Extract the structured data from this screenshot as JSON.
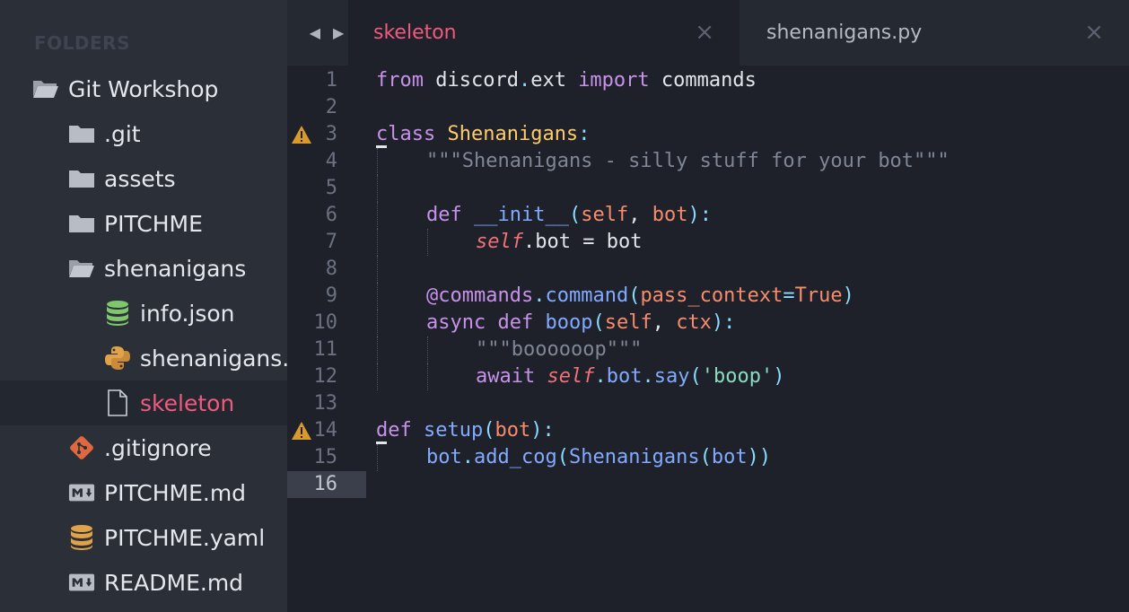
{
  "sidebar": {
    "header": "FOLDERS",
    "items": [
      {
        "label": "Git Workshop",
        "icon": "folder-open-icon"
      },
      {
        "label": ".git",
        "icon": "folder-icon"
      },
      {
        "label": "assets",
        "icon": "folder-icon"
      },
      {
        "label": "PITCHME",
        "icon": "folder-icon"
      },
      {
        "label": "shenanigans",
        "icon": "folder-open-icon"
      },
      {
        "label": "info.json",
        "icon": "database-icon"
      },
      {
        "label": "shenanigans.",
        "icon": "python-icon"
      },
      {
        "label": "skeleton",
        "icon": "file-icon"
      },
      {
        "label": ".gitignore",
        "icon": "git-icon"
      },
      {
        "label": "PITCHME.md",
        "icon": "markdown-icon"
      },
      {
        "label": "PITCHME.yaml",
        "icon": "database-icon"
      },
      {
        "label": "README.md",
        "icon": "markdown-icon"
      }
    ]
  },
  "tabs": [
    {
      "label": "skeleton",
      "active": true,
      "close": "×"
    },
    {
      "label": "shenanigans.py",
      "active": false,
      "close": "×"
    }
  ],
  "nav": {
    "back": "◀",
    "forward": "▶"
  },
  "editor": {
    "current_line": 16,
    "warnings_on_lines": [
      3,
      14
    ],
    "line_numbers": [
      "1",
      "2",
      "3",
      "4",
      "5",
      "6",
      "7",
      "8",
      "9",
      "10",
      "11",
      "12",
      "13",
      "14",
      "15",
      "16"
    ],
    "code": {
      "l1": [
        "from",
        " discord",
        ".",
        "ext ",
        "import",
        " commands"
      ],
      "l3": [
        "class",
        " ",
        "Shenanigans",
        ":"
      ],
      "l4": [
        "\"\"\"Shenanigans - silly stuff for your bot\"\"\""
      ],
      "l6": [
        "def",
        " ",
        "__init__",
        "(",
        "self",
        ", ",
        "bot",
        "):"
      ],
      "l7": [
        "self",
        ".bot = bot"
      ],
      "l9": [
        "@commands",
        ".",
        "command",
        "(",
        "pass_context",
        "=",
        "True",
        ")"
      ],
      "l10": [
        "async def",
        " ",
        "boop",
        "(",
        "self",
        ", ",
        "ctx",
        "):"
      ],
      "l11": [
        "\"\"\"boooooop\"\"\""
      ],
      "l12": [
        "await",
        " ",
        "self",
        ".",
        "bot",
        ".",
        "say",
        "(",
        "'boop'",
        ")"
      ],
      "l14": [
        "def",
        " ",
        "setup",
        "(",
        "bot",
        "):"
      ],
      "l15": [
        "bot",
        ".",
        "add_cog",
        "(",
        "Shenanigans",
        "(",
        "bot",
        "))"
      ]
    }
  },
  "colors": {
    "background": "#1e2129",
    "sidebar": "#2b2f38",
    "accent": "#ef5a7e",
    "keyword": "#c792ea",
    "class": "#ffcb6b",
    "function": "#82aaff",
    "string": "#89ddc0"
  }
}
